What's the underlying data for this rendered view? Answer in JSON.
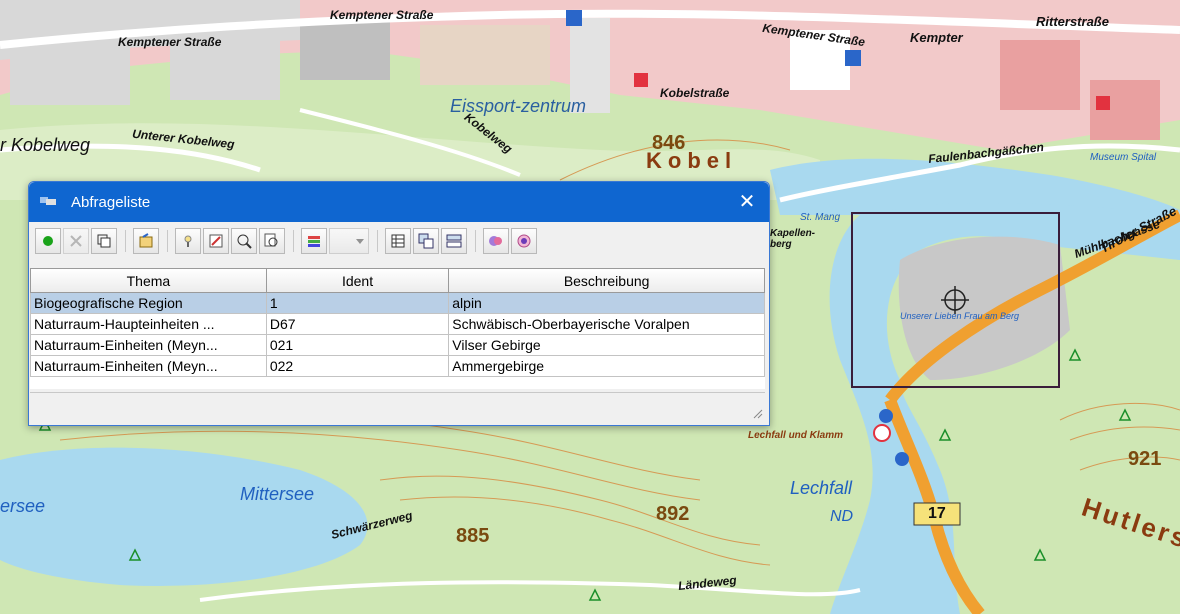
{
  "map": {
    "streets": {
      "kemptener_1": "Kemptener Straße",
      "kemptener_2": "Kemptener Straße",
      "kemptener_3": "Kemptener Straße",
      "kemptener_4": "Kempter",
      "ritter": "Ritterstraße",
      "unterer_kobelweg": "Unterer Kobelweg",
      "kobelweg": "Kobelweg",
      "kobelstrasse": "Kobelstraße",
      "faulenbachgasschen": "Faulenbachgäßchen",
      "muehlbachgasse": "Mühlbachgasse",
      "tiroler": "Tiroler Straße",
      "laendeweg": "Ländeweg",
      "schwaerzerweg": "Schwärzerweg",
      "kobelweg_left": "r Kobelweg"
    },
    "places": {
      "eissport": "Eissport-zentrum",
      "kobel": "Kobel",
      "mittersee": "Mittersee",
      "ersee": "ersee",
      "lechfall": "Lechfall",
      "nd": "ND",
      "huttlers": "Hutlers",
      "kapellen": "Kapellen-berg",
      "lechfall_klamm": "Lechfall und Klamm",
      "st_mang": "St. Mang",
      "munster": "Museum Spital",
      "lieberfrau": "Unserer Lieben Frau am Berg"
    },
    "heights": {
      "h846": "846",
      "h892": "892",
      "h885": "885",
      "h921": "921"
    },
    "road_number": "17"
  },
  "dialog": {
    "title": "Abfrageliste",
    "close_symbol": "✕",
    "columns": [
      "Thema",
      "Ident",
      "Beschreibung"
    ],
    "rows": [
      {
        "thema": "Biogeografische Region",
        "ident": "1",
        "beschreibung": "alpin",
        "selected": true
      },
      {
        "thema": "Naturraum-Haupteinheiten ...",
        "ident": "D67",
        "beschreibung": "Schwäbisch-Oberbayerische Voralpen",
        "selected": false
      },
      {
        "thema": "Naturraum-Einheiten (Meyn...",
        "ident": "021",
        "beschreibung": "Vilser Gebirge",
        "selected": false
      },
      {
        "thema": "Naturraum-Einheiten (Meyn...",
        "ident": "022",
        "beschreibung": "Ammergebirge",
        "selected": false
      }
    ],
    "toolbar": [
      "activate-icon",
      "delete-icon",
      "copy-frame-icon",
      "export-icon",
      "info-icon",
      "edit-query-icon",
      "zoom-to-icon",
      "zoom-extent-icon",
      "layers-icon",
      "layer-dropdown-icon",
      "table-icon",
      "copy-table-icon",
      "compare-icon",
      "highlight-icon",
      "select-shape-icon"
    ]
  },
  "colors": {
    "titlebar": "#0f66d0",
    "selected_row": "#b9cfe6",
    "water": "#a9d9ef",
    "forest": "#cfe7b4",
    "urban": "#f1c6c6"
  }
}
